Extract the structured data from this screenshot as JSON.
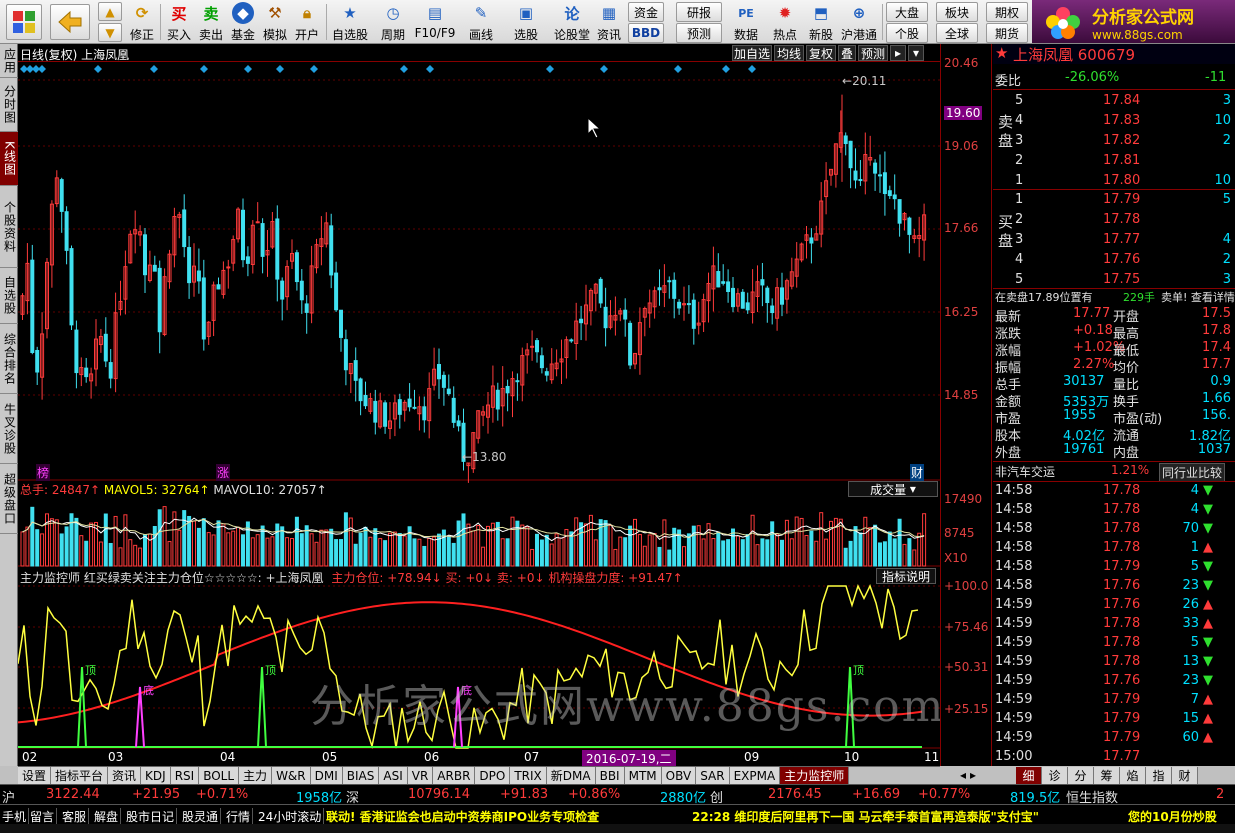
{
  "toolbar": {
    "buttons": [
      "买入",
      "卖出",
      "基金",
      "模拟",
      "开户",
      "自选股",
      "周期",
      "F10/F9",
      "画线",
      "选股",
      "论股堂",
      "资讯",
      "数据",
      "热点",
      "新股",
      "沪港通",
      "修正"
    ],
    "small_buttons": [
      "资金",
      "BBD",
      "研报",
      "预测",
      "大盘",
      "个股",
      "板块",
      "全球",
      "期权",
      "期货"
    ],
    "icon_labels": {
      "buy": "买",
      "sell": "卖"
    }
  },
  "brand": {
    "title": "分析家公式网",
    "url": "www.88gs.com"
  },
  "left_tabs": [
    "应用",
    "分时图",
    "K线图",
    "个股资料",
    "自选股",
    "综合排名",
    "牛叉诊股",
    "超级盘口"
  ],
  "chart": {
    "title": "日线(复权) 上海凤凰",
    "header_buttons": [
      "加自选",
      "均线",
      "复权",
      "叠",
      "预测"
    ],
    "volume_label": "总手: 24847↑ MAVOL5: 32764↑ MAVOL10: 27057↑",
    "volume_total": "总手: 24847↑",
    "volume_ma5": "MAVOL5: 32764↑",
    "volume_ma10": "MAVOL10: 27057↑",
    "volume_button": "成交量",
    "indicator_title": "主力监控师 红买绿卖关注主力仓位☆☆☆☆☆: +上海凤凰",
    "indicator_values": "主力仓位: +78.94↓ 买: +0↓ 卖: +0↓ 机构操盘力度: +91.47↑",
    "indicator_button": "指标说明",
    "price_max_label": "20.11",
    "price_min_label": "13.80",
    "markers": {
      "bang": "榜",
      "zhang": "涨",
      "cai": "财",
      "ding": "顶",
      "di": "底"
    },
    "date_cursor": "2016-07-19,二",
    "months": [
      "02",
      "03",
      "04",
      "05",
      "06",
      "07",
      "08",
      "09",
      "10",
      "11"
    ],
    "watermark": "分析家公式网www.88gs.com"
  },
  "chart_data": {
    "type": "candlestick",
    "price_axis": [
      "20.46",
      "19.60",
      "19.06",
      "17.66",
      "16.25",
      "14.85"
    ],
    "volume_axis": [
      "17490",
      "8745",
      "X10"
    ],
    "indicator_axis": [
      "+100.0",
      "+75.46",
      "+50.31",
      "+25.15"
    ],
    "price_range": [
      13.5,
      20.5
    ],
    "high": 20.11,
    "low": 13.8
  },
  "right_panel": {
    "title": "上海凤凰 600679",
    "weibi": {
      "label": "委比",
      "value": "-26.06%",
      "diff": "-11"
    },
    "sell_label": "卖盘",
    "buy_label": "买盘",
    "sell": [
      {
        "lvl": "5",
        "price": "17.84",
        "vol": "3"
      },
      {
        "lvl": "4",
        "price": "17.83",
        "vol": "10"
      },
      {
        "lvl": "3",
        "price": "17.82",
        "vol": "2"
      },
      {
        "lvl": "2",
        "price": "17.81",
        "vol": ""
      },
      {
        "lvl": "1",
        "price": "17.80",
        "vol": "10"
      }
    ],
    "buy": [
      {
        "lvl": "1",
        "price": "17.79",
        "vol": "5"
      },
      {
        "lvl": "2",
        "price": "17.78",
        "vol": ""
      },
      {
        "lvl": "3",
        "price": "17.77",
        "vol": "4"
      },
      {
        "lvl": "4",
        "price": "17.76",
        "vol": "2"
      },
      {
        "lvl": "5",
        "price": "17.75",
        "vol": "3"
      }
    ],
    "notice": "在卖盘17.89位置有 229手 卖单! 查看详情",
    "notice_a": "在卖盘17.89位置有",
    "notice_b": "229手",
    "notice_c": "卖单! 查看详情",
    "stats": [
      {
        "l": "最新",
        "v": "17.77",
        "l2": "开盘",
        "v2": "17.5"
      },
      {
        "l": "涨跌",
        "v": "+0.18",
        "l2": "最高",
        "v2": "17.8"
      },
      {
        "l": "涨幅",
        "v": "+1.02%",
        "l2": "最低",
        "v2": "17.4"
      },
      {
        "l": "振幅",
        "v": "2.27%",
        "l2": "均价",
        "v2": "17.7"
      },
      {
        "l": "总手",
        "v": "30137",
        "l2": "量比",
        "v2": "0.9"
      },
      {
        "l": "金额",
        "v": "5353万",
        "l2": "换手",
        "v2": "1.66"
      },
      {
        "l": "市盈",
        "v": "1955",
        "l2": "市盈(动)",
        "v2": "156."
      },
      {
        "l": "股本",
        "v": "4.02亿",
        "l2": "流通",
        "v2": "1.82亿"
      },
      {
        "l": "外盘",
        "v": "19761",
        "l2": "内盘",
        "v2": "1037"
      }
    ],
    "sector": {
      "name": "非汽车交运",
      "pct": "1.21%",
      "btn": "同行业比较"
    },
    "ticks": [
      {
        "t": "14:58",
        "p": "17.78",
        "v": "4",
        "d": "down"
      },
      {
        "t": "14:58",
        "p": "17.78",
        "v": "4",
        "d": "down"
      },
      {
        "t": "14:58",
        "p": "17.78",
        "v": "70",
        "d": "down"
      },
      {
        "t": "14:58",
        "p": "17.78",
        "v": "1",
        "d": "up"
      },
      {
        "t": "14:58",
        "p": "17.79",
        "v": "5",
        "d": "down"
      },
      {
        "t": "14:58",
        "p": "17.76",
        "v": "23",
        "d": "down"
      },
      {
        "t": "14:59",
        "p": "17.76",
        "v": "26",
        "d": "up"
      },
      {
        "t": "14:59",
        "p": "17.78",
        "v": "33",
        "d": "up"
      },
      {
        "t": "14:59",
        "p": "17.78",
        "v": "5",
        "d": "down"
      },
      {
        "t": "14:59",
        "p": "17.78",
        "v": "13",
        "d": "down"
      },
      {
        "t": "14:59",
        "p": "17.76",
        "v": "23",
        "d": "down"
      },
      {
        "t": "14:59",
        "p": "17.79",
        "v": "7",
        "d": "up"
      },
      {
        "t": "14:59",
        "p": "17.79",
        "v": "15",
        "d": "up"
      },
      {
        "t": "14:59",
        "p": "17.79",
        "v": "60",
        "d": "up"
      },
      {
        "t": "15:00",
        "p": "17.77",
        "v": "",
        "d": ""
      }
    ]
  },
  "bottom_tabs": [
    "设置",
    "指标平台",
    "资讯",
    "KDJ",
    "RSI",
    "BOLL",
    "主力",
    "W&R",
    "DMI",
    "BIAS",
    "ASI",
    "VR",
    "ARBR",
    "DPO",
    "TRIX",
    "新DMA",
    "BBI",
    "MTM",
    "OBV",
    "SAR",
    "EXPMA",
    "主力监控师"
  ],
  "right_tabs": [
    "细",
    "诊",
    "分",
    "筹",
    "焰",
    "指",
    "财"
  ],
  "status": {
    "sh_label": "沪",
    "sh_idx": "3122.44",
    "sh_chg": "+21.95",
    "sh_pct": "+0.71%",
    "sh_amt": "1958亿",
    "sz_label": "深",
    "sz_idx": "10796.14",
    "sz_chg": "+91.83",
    "sz_pct": "+0.86%",
    "sz_amt": "2880亿",
    "cy_label": "创",
    "cy_idx": "2176.45",
    "cy_chg": "+16.69",
    "cy_pct": "+0.77%",
    "cy_amt": "819.5亿",
    "hs_label": "恒生指数",
    "hs_val": "2"
  },
  "news": {
    "tabs": [
      "手机",
      "留言",
      "客服",
      "解盘",
      "股市日记",
      "股灵通",
      "行情",
      "24小时滚动"
    ],
    "ticker1": "联动! 香港证监会也启动中资券商IPO业务专项检查",
    "ticker2": "22:28 维印度后阿里再下一国 马云牵手泰首富再造泰版\"支付宝\"",
    "ticker3": "您的10月份炒股"
  }
}
